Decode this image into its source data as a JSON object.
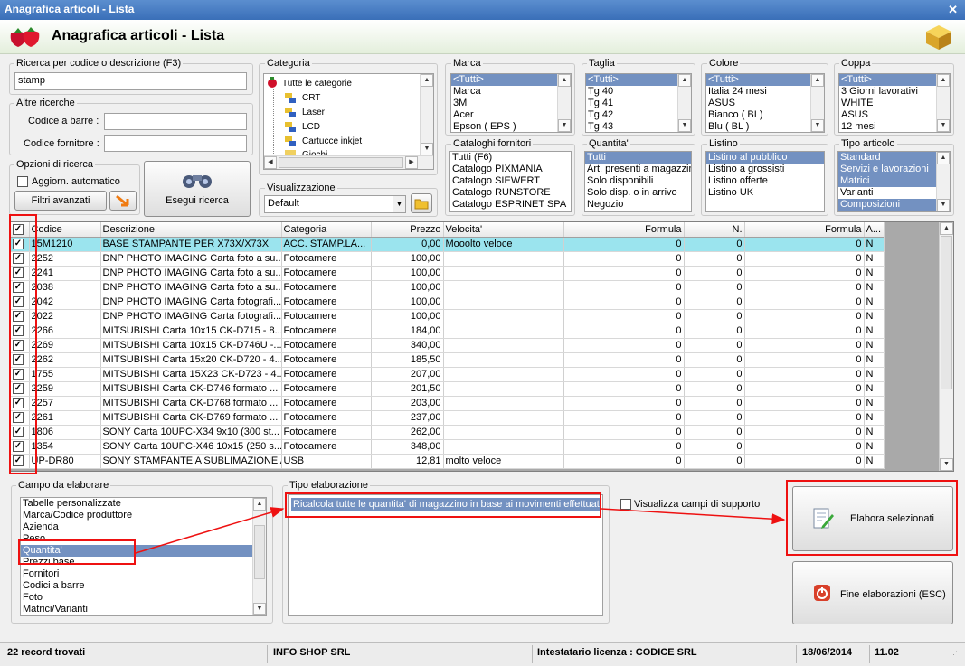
{
  "window": {
    "title": "Anagrafica articoli  - Lista",
    "header": "Anagrafica articoli  - Lista"
  },
  "search": {
    "label": "Ricerca per codice o descrizione (F3)",
    "value": "stamp"
  },
  "altre": {
    "label": "Altre ricerche",
    "barcode_label": "Codice a barre :",
    "barcode_value": "",
    "fornitore_label": "Codice fornitore :",
    "fornitore_value": ""
  },
  "opzioni": {
    "label": "Opzioni di ricerca",
    "auto_label": "Aggiorn. automatico",
    "filtri_label": "Filtri avanzati",
    "esegui_label": "Esegui ricerca"
  },
  "categoria": {
    "label": "Categoria",
    "items": [
      "Tutte le categorie",
      "CRT",
      "Laser",
      "LCD",
      "Cartucce inkjet",
      "Giochi"
    ]
  },
  "visualizzazione": {
    "label": "Visualizzazione",
    "value": "Default"
  },
  "marca": {
    "label": "Marca",
    "items": [
      "<Tutti>",
      "Marca",
      "3M",
      "Acer",
      "Epson ( EPS )"
    ]
  },
  "taglia": {
    "label": "Taglia",
    "items": [
      "<Tutti>",
      "Tg 40",
      "Tg 41",
      "Tg 42",
      "Tg 43"
    ]
  },
  "colore": {
    "label": "Colore",
    "items": [
      "<Tutti>",
      "Italia 24 mesi",
      "ASUS",
      "Bianco ( BI )",
      "Blu ( BL )"
    ]
  },
  "coppa": {
    "label": "Coppa",
    "items": [
      "<Tutti>",
      "3 Giorni lavorativi",
      "WHITE",
      "ASUS",
      "12 mesi"
    ]
  },
  "cataloghi": {
    "label": "Cataloghi fornitori",
    "items": [
      "Tutti (F6)",
      "Catalogo PIXMANIA",
      "Catalogo SIEWERT",
      "Catalogo RUNSTORE",
      "Catalogo ESPRINET SPA"
    ]
  },
  "quantita": {
    "label": "Quantita'",
    "items": [
      "Tutti",
      "Art. presenti a magazzino",
      "Solo disponibili",
      "Solo disp. o in arrivo",
      "Negozio"
    ]
  },
  "listino": {
    "label": "Listino",
    "items": [
      "Listino al pubblico",
      "Listino a grossisti",
      "Listino offerte",
      "Listino UK"
    ]
  },
  "tipo_articolo": {
    "label": "Tipo articolo",
    "items": [
      "Standard",
      "Servizi e lavorazioni",
      "Matrici",
      "Varianti",
      "Composizioni"
    ]
  },
  "grid": {
    "columns": [
      "Codice",
      "Descrizione",
      "Categoria",
      "Prezzo",
      "Velocita'",
      "Formula",
      "N.",
      "Formula",
      "A..."
    ],
    "rows": [
      [
        "15M1210",
        "BASE STAMPANTE PER X73X/X73X",
        "ACC. STAMP.LA...",
        "0,00",
        "Mooolto veloce",
        "0",
        "0",
        "0",
        "N"
      ],
      [
        "2252",
        "DNP PHOTO IMAGING Carta foto a su...",
        "Fotocamere",
        "100,00",
        "",
        "0",
        "0",
        "0",
        "N"
      ],
      [
        "2241",
        "DNP PHOTO IMAGING Carta foto a su...",
        "Fotocamere",
        "100,00",
        "",
        "0",
        "0",
        "0",
        "N"
      ],
      [
        "2038",
        "DNP PHOTO IMAGING Carta foto a su...",
        "Fotocamere",
        "100,00",
        "",
        "0",
        "0",
        "0",
        "N"
      ],
      [
        "2042",
        "DNP PHOTO IMAGING Carta fotografi...",
        "Fotocamere",
        "100,00",
        "",
        "0",
        "0",
        "0",
        "N"
      ],
      [
        "2022",
        "DNP PHOTO IMAGING Carta fotografi...",
        "Fotocamere",
        "100,00",
        "",
        "0",
        "0",
        "0",
        "N"
      ],
      [
        "2266",
        "MITSUBISHI Carta 10x15 CK-D715 - 8...",
        "Fotocamere",
        "184,00",
        "",
        "0",
        "0",
        "0",
        "N"
      ],
      [
        "2269",
        "MITSUBISHI Carta 10x15 CK-D746U -...",
        "Fotocamere",
        "340,00",
        "",
        "0",
        "0",
        "0",
        "N"
      ],
      [
        "2262",
        "MITSUBISHI Carta 15x20 CK-D720 - 4...",
        "Fotocamere",
        "185,50",
        "",
        "0",
        "0",
        "0",
        "N"
      ],
      [
        "1755",
        "MITSUBISHI Carta 15X23 CK-D723 - 4...",
        "Fotocamere",
        "207,00",
        "",
        "0",
        "0",
        "0",
        "N"
      ],
      [
        "2259",
        "MITSUBISHI Carta CK-D746 formato ...",
        "Fotocamere",
        "201,50",
        "",
        "0",
        "0",
        "0",
        "N"
      ],
      [
        "2257",
        "MITSUBISHI Carta CK-D768 formato ...",
        "Fotocamere",
        "203,00",
        "",
        "0",
        "0",
        "0",
        "N"
      ],
      [
        "2261",
        "MITSUBISHI Carta CK-D769 formato ...",
        "Fotocamere",
        "237,00",
        "",
        "0",
        "0",
        "0",
        "N"
      ],
      [
        "1806",
        "SONY Carta 10UPC-X34 9x10 (300 st...",
        "Fotocamere",
        "262,00",
        "",
        "0",
        "0",
        "0",
        "N"
      ],
      [
        "1354",
        "SONY Carta 10UPC-X46 10x15 (250 s...",
        "Fotocamere",
        "348,00",
        "",
        "0",
        "0",
        "0",
        "N"
      ],
      [
        "UP-DR80",
        "SONY STAMPANTE A SUBLIMAZIONE A4",
        "USB",
        "12,81",
        "molto veloce",
        "0",
        "0",
        "0",
        "N"
      ]
    ]
  },
  "campo": {
    "label": "Campo da elaborare",
    "items": [
      "Tabelle personalizzate",
      "Marca/Codice produttore",
      "Azienda",
      "Peso",
      "Quantita'",
      "Prezzi base",
      "Fornitori",
      "Codici a barre",
      "Foto",
      "Matrici/Varianti"
    ]
  },
  "tipo_elab": {
    "label": "Tipo elaborazione",
    "value": "Ricalcola tutte le quantita' di magazzino in base ai movimenti effettuati"
  },
  "supporto_label": "Visualizza campi di supporto",
  "elabora_label": "Elabora selezionati",
  "fine_label": "Fine elaborazioni (ESC)",
  "status": {
    "records": "22 record trovati",
    "company": "INFO SHOP SRL",
    "licenza": "Intestatario licenza : CODICE SRL",
    "date": "18/06/2014",
    "version": "11.02"
  }
}
